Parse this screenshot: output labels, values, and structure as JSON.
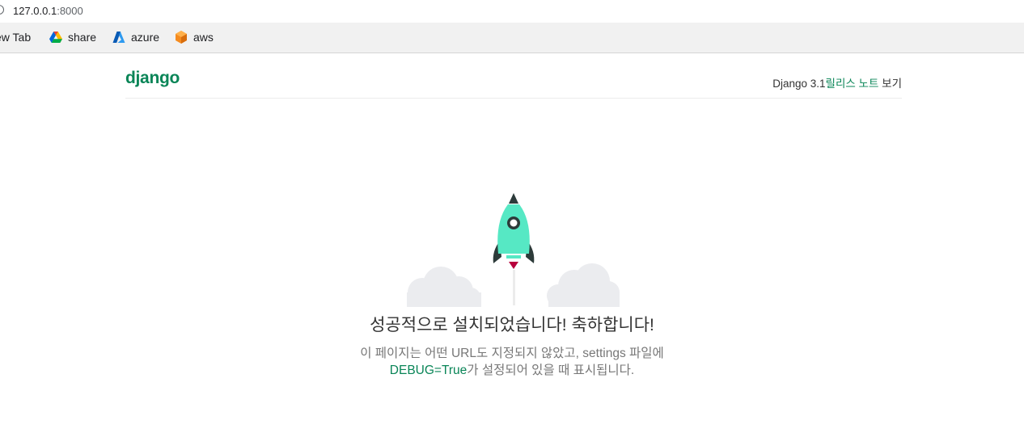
{
  "browser": {
    "url_host": "127.0.0.1",
    "url_port": ":8000",
    "bookmarks": [
      {
        "label": "ew Tab",
        "icon": "new-tab"
      },
      {
        "label": "share",
        "icon": "google-drive-icon"
      },
      {
        "label": "azure",
        "icon": "azure-icon"
      },
      {
        "label": "aws",
        "icon": "aws-icon"
      }
    ]
  },
  "header": {
    "logo": "django",
    "release_prefix": "Django 3.1",
    "release_link": "릴리스 노트",
    "release_suffix": " 보기"
  },
  "main": {
    "title": "성공적으로 설치되었습니다! 축하합니다!",
    "subtitle_line1": "이 페이지는 어떤 URL도 지정되지 않았고, settings 파일에",
    "debug_code": "DEBUG=True",
    "subtitle_line2_rest": "가 설정되어 있을 때 표시됩니다."
  },
  "colors": {
    "brand": "#098557",
    "rocket_body": "#56e8c4",
    "rocket_dark": "#2d3b3a",
    "flame": "#b8003d",
    "cloud": "#ebecef"
  }
}
